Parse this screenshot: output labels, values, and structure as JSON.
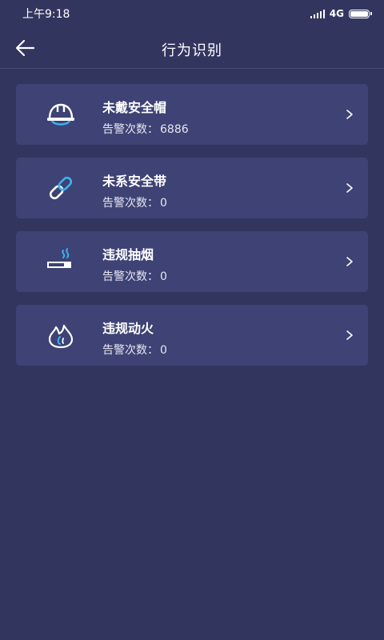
{
  "status": {
    "time": "上午9:18",
    "network": "4G"
  },
  "header": {
    "title": "行为识别"
  },
  "cards": [
    {
      "title": "未戴安全帽",
      "count_label": "告警次数：",
      "count": "6886",
      "icon": "helmet-icon"
    },
    {
      "title": "未系安全带",
      "count_label": "告警次数：",
      "count": "0",
      "icon": "link-icon"
    },
    {
      "title": "违规抽烟",
      "count_label": "告警次数：",
      "count": "0",
      "icon": "cigarette-icon"
    },
    {
      "title": "违规动火",
      "count_label": "告警次数：",
      "count": "0",
      "icon": "fire-icon"
    }
  ],
  "colors": {
    "background": "#32365f",
    "card": "#3e4274",
    "accent": "#3ab4f2"
  }
}
